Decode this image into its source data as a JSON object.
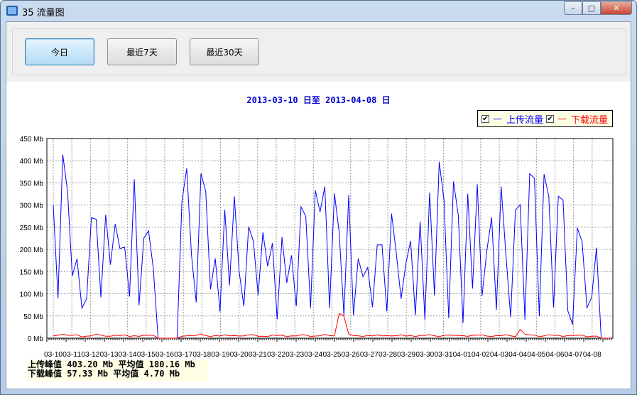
{
  "window": {
    "title": "35 流量图",
    "min": "–",
    "max": "□",
    "close": "✕"
  },
  "buttons": [
    {
      "label": "今日"
    },
    {
      "label": "最近7天"
    },
    {
      "label": "最近30天"
    }
  ],
  "colors": {
    "upload": "#0000ff",
    "download": "#ff0000",
    "title": "#0000cc"
  },
  "chart_data": {
    "type": "line",
    "title": "2013-03-10 日至 2013-04-08 日",
    "ylabel": "Mb",
    "ylim": [
      0,
      450
    ],
    "yticks": [
      "0 Mb",
      "50 Mb",
      "100 Mb",
      "150 Mb",
      "200 Mb",
      "250 Mb",
      "300 Mb",
      "350 Mb",
      "400 Mb",
      "450 Mb"
    ],
    "categories": [
      "03-10",
      "03-11",
      "03-12",
      "03-13",
      "03-14",
      "03-15",
      "03-16",
      "03-17",
      "03-18",
      "03-19",
      "03-20",
      "03-21",
      "03-22",
      "03-23",
      "03-24",
      "03-25",
      "03-26",
      "03-27",
      "03-28",
      "03-29",
      "03-30",
      "03-31",
      "04-01",
      "04-02",
      "04-03",
      "04-04",
      "04-05",
      "04-06",
      "04-07",
      "04-08"
    ],
    "legend": {
      "position": "top-right",
      "items": [
        {
          "label": "上传流量",
          "checked": true
        },
        {
          "label": "下载流量",
          "checked": true
        }
      ]
    },
    "series": [
      {
        "name": "上传流量",
        "values": [
          300,
          80,
          403,
          330,
          150,
          190,
          70,
          80,
          260,
          265,
          100,
          290,
          170,
          250,
          190,
          200,
          100,
          370,
          80,
          220,
          230,
          150,
          0,
          0,
          0,
          0,
          0,
          300,
          385,
          200,
          90,
          370,
          320,
          100,
          180,
          70,
          300,
          120,
          310,
          140,
          70,
          260,
          230,
          100,
          230,
          150,
          210,
          50,
          240,
          130,
          180,
          60,
          290,
          280,
          80,
          340,
          280,
          330,
          60,
          330,
          250,
          60,
          320,
          40,
          170,
          140,
          170,
          80,
          210,
          200,
          50,
          280,
          200,
          100,
          170,
          210,
          40,
          260,
          50,
          340,
          100,
          390,
          300,
          40,
          360,
          290,
          40,
          320,
          100,
          340,
          100,
          210,
          280,
          60,
          330,
          180,
          50,
          300,
          310,
          40,
          360,
          350,
          50,
          380,
          330,
          70,
          310,
          300,
          60,
          40,
          260,
          220,
          60,
          80,
          200,
          0,
          0,
          0
        ]
      },
      {
        "name": "下载流量",
        "values": [
          5,
          8,
          10,
          6,
          5,
          7,
          4,
          6,
          5,
          8,
          6,
          5,
          6,
          7,
          5,
          6,
          4,
          7,
          5,
          6,
          5,
          6,
          0,
          0,
          0,
          0,
          0,
          5,
          7,
          6,
          5,
          8,
          6,
          5,
          7,
          4,
          6,
          5,
          7,
          6,
          5,
          6,
          7,
          5,
          6,
          4,
          6,
          5,
          7,
          5,
          6,
          4,
          6,
          7,
          5,
          6,
          5,
          7,
          5,
          6,
          57,
          50,
          8,
          5,
          6,
          5,
          7,
          4,
          6,
          5,
          7,
          6,
          5,
          6,
          4,
          7,
          5,
          6,
          5,
          7,
          6,
          5,
          7,
          6,
          5,
          6,
          7,
          5,
          6,
          5,
          7,
          6,
          5,
          6,
          4,
          7,
          6,
          5,
          20,
          8,
          6,
          7,
          5,
          6,
          7,
          5,
          6,
          5,
          7,
          6,
          5,
          6,
          4,
          6,
          5,
          0,
          0,
          0
        ]
      }
    ]
  },
  "stats": {
    "up_peak_label": "上传峰值",
    "up_peak": "403.20 Mb",
    "up_avg_label": "平均值",
    "up_avg": "180.16 Mb",
    "down_peak_label": "下载峰值",
    "down_peak": "57.33 Mb",
    "down_avg_label": "平均值",
    "down_avg": "4.70 Mb"
  }
}
